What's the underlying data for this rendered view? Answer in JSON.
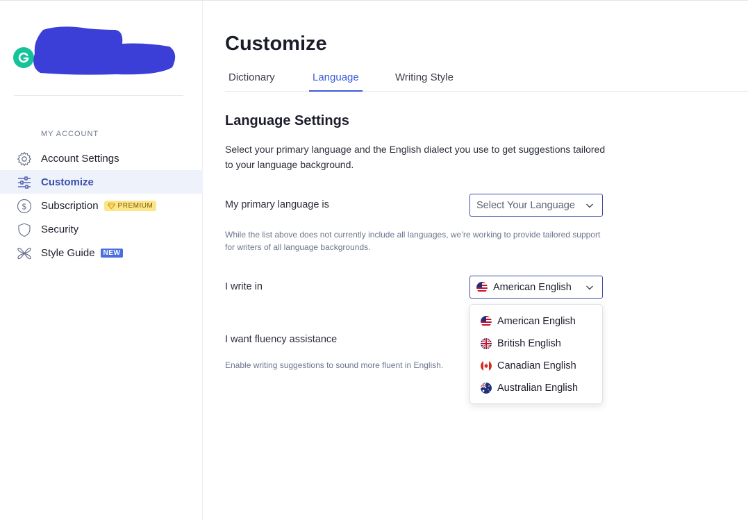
{
  "sidebar": {
    "section_label": "MY ACCOUNT",
    "items": [
      {
        "label": "Account Settings",
        "icon": "gear-icon"
      },
      {
        "label": "Customize",
        "icon": "sliders-icon",
        "active": true
      },
      {
        "label": "Subscription",
        "icon": "dollar-icon",
        "badge": "PREMIUM"
      },
      {
        "label": "Security",
        "icon": "shield-icon"
      },
      {
        "label": "Style Guide",
        "icon": "style-guide-icon",
        "badge": "NEW"
      }
    ]
  },
  "main": {
    "title": "Customize",
    "tabs": [
      {
        "label": "Dictionary"
      },
      {
        "label": "Language",
        "active": true
      },
      {
        "label": "Writing Style"
      }
    ],
    "section_title": "Language Settings",
    "description": "Select your primary language and the English dialect you use to get suggestions tailored to your language background.",
    "primary_language": {
      "label": "My primary language is",
      "placeholder": "Select Your Language",
      "hint": "While the list above does not currently include all languages, we’re working to provide tailored support for writers of all language backgrounds."
    },
    "dialect": {
      "label": "I write in",
      "selected": "American English",
      "options": [
        "American English",
        "British English",
        "Canadian English",
        "Australian English"
      ]
    },
    "fluency": {
      "label": "I want fluency assistance",
      "hint": "Enable writing suggestions to sound more fluent in English."
    }
  },
  "colors": {
    "accent": "#3b5bdb",
    "active_nav_bg": "#eef2fb",
    "brand_green": "#15c39a",
    "premium_badge": "#fde58a",
    "new_badge": "#4a6ee0"
  }
}
